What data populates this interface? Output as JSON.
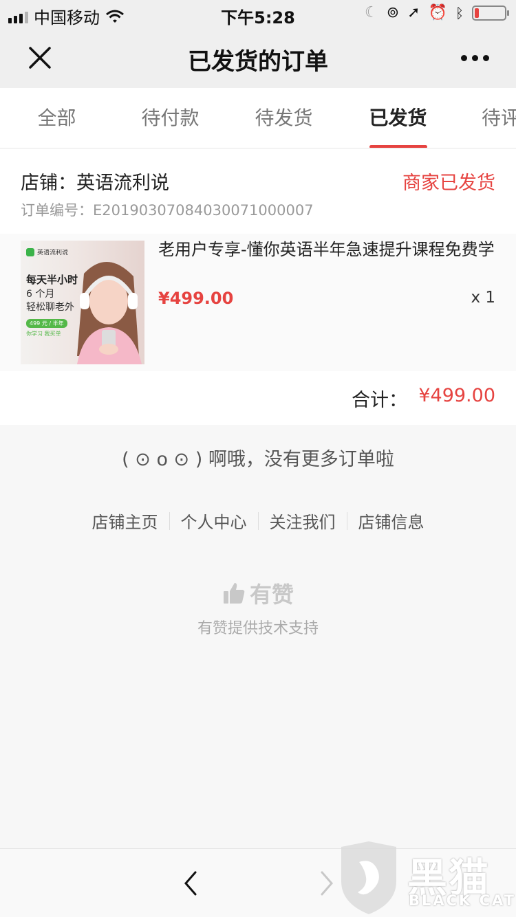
{
  "status_bar": {
    "carrier": "中国移动",
    "time": "下午5:28",
    "battery_level": 0.15,
    "battery_color": "#e64340"
  },
  "nav": {
    "title": "已发货的订单",
    "close_icon": "close-icon",
    "more_icon": "more-dots-icon"
  },
  "tabs": [
    {
      "label": "全部",
      "active": false
    },
    {
      "label": "待付款",
      "active": false
    },
    {
      "label": "待发货",
      "active": false
    },
    {
      "label": "已发货",
      "active": true
    },
    {
      "label": "待评价",
      "active": false
    }
  ],
  "order": {
    "shop": "店铺：英语流利说",
    "status": "商家已发货",
    "order_no": "订单编号：E20190307084030071000007",
    "goods": {
      "title": "老用户专享-懂你英语半年急速提升课程免费学",
      "price": "¥499.00",
      "qty": "x 1",
      "image": {
        "brand": "英语流利说",
        "line1": "每天半小时",
        "line2": "6 个月",
        "line3": "轻松聊老外",
        "pill": "499 元 / 半年",
        "tag": "你学习 我买单"
      }
    },
    "total_label": "合计：",
    "total_amount": "¥499.00"
  },
  "no_more": "( ⊙ o ⊙ ) 啊哦，没有更多订单啦",
  "footer_links": [
    "店铺主页",
    "个人中心",
    "关注我们",
    "店铺信息"
  ],
  "youzan": {
    "name": "有赞",
    "support": "有赞提供技术支持",
    "icon": "thumbs-up-icon"
  },
  "watermark": {
    "text": "黑猫",
    "sub": "BLACK CAT"
  },
  "colors": {
    "accent": "#e64340",
    "nav_bg": "#efefef"
  }
}
